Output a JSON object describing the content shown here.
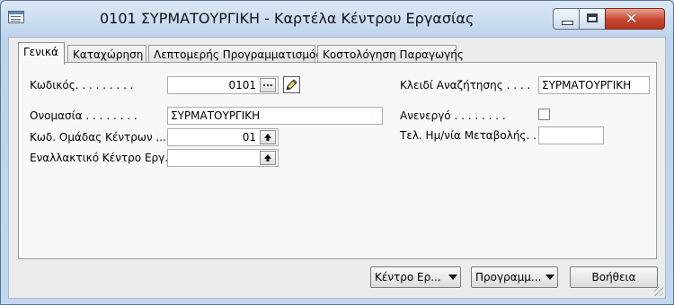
{
  "window": {
    "title": "0101 ΣΥΡΜΑΤΟΥΡΓΙΚΗ - Καρτέλα Κέντρου Εργασίας",
    "close_symbol": "✕"
  },
  "tabs": [
    {
      "label": "Γενικά",
      "active": true
    },
    {
      "label": "Καταχώρηση",
      "active": false
    },
    {
      "label": "Λεπτομερής Προγραμματισμός",
      "active": false
    },
    {
      "label": "Κοστολόγηση Παραγωγής",
      "active": false
    }
  ],
  "form": {
    "code": {
      "label": "Κωδικός. . . . . . . . .",
      "value": "0101",
      "assist_label": "..."
    },
    "name": {
      "label": "Ονομασία . . . . . . . .",
      "value": "ΣΥΡΜΑΤΟΥΡΓΙΚΗ"
    },
    "group_code": {
      "label": "Κωδ. Ομάδας Κέντρων ...",
      "value": "01"
    },
    "alt_center": {
      "label": "Εναλλακτικό Κέντρο Εργ...",
      "value": ""
    },
    "search_key": {
      "label": "Κλειδί Αναζήτησης . . . .",
      "value": "ΣΥΡΜΑΤΟΥΡΓΙΚΗ"
    },
    "inactive": {
      "label": "Ανενεργό . . . . . . . .",
      "checked": false
    },
    "last_modified": {
      "label": "Τελ. Ημ/νία Μεταβολής. .",
      "value": ""
    }
  },
  "buttons": {
    "work_center": "Κέντρο Ερ...",
    "planning": "Προγραμμ...",
    "help": "Βοήθεια"
  },
  "icons": {
    "app": "form-window-icon",
    "lookup_arrow": "up-arrow-icon",
    "edit": "pencil-icon"
  }
}
